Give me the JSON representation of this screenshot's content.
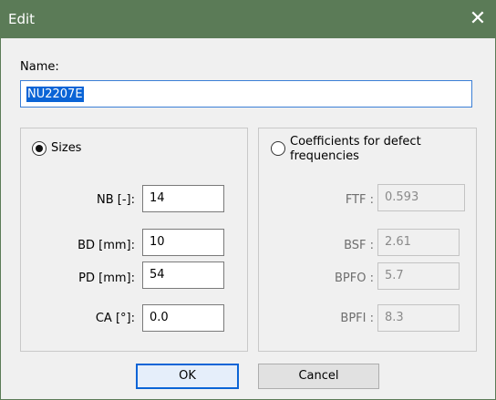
{
  "window": {
    "title": "Edit",
    "close_symbol": "✕"
  },
  "name": {
    "label": "Name:",
    "value": "NU2207E"
  },
  "sizes": {
    "radio_label": "Sizes",
    "selected": true,
    "fields": [
      {
        "label": "NB [-]:",
        "value": "14"
      },
      {
        "label": "BD [mm]:",
        "value": "10"
      },
      {
        "label": "PD [mm]:",
        "value": "54"
      },
      {
        "label": "CA [°]:",
        "value": "0.0"
      }
    ]
  },
  "coefficients": {
    "radio_label_line1": "Coefficients for defect",
    "radio_label_line2": "frequencies",
    "selected": false,
    "fields": [
      {
        "label": "FTF :",
        "value": "0.593"
      },
      {
        "label": "BSF :",
        "value": "2.61"
      },
      {
        "label": "BPFO :",
        "value": "5.7"
      },
      {
        "label": "BPFI :",
        "value": "8.3"
      }
    ]
  },
  "buttons": {
    "ok": "OK",
    "cancel": "Cancel"
  }
}
